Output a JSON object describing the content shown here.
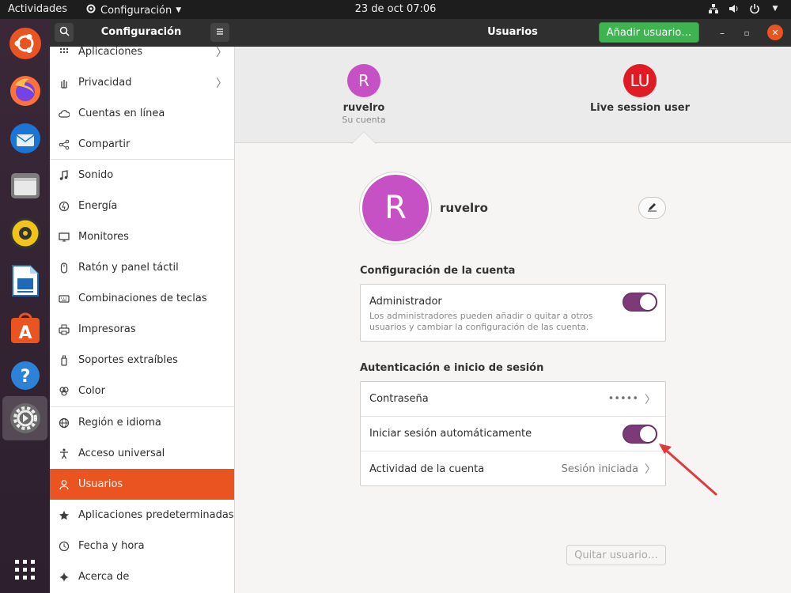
{
  "topbar": {
    "activities": "Actividades",
    "app_name": "Configuración",
    "clock": "23 de oct  07:06",
    "tray_icons": [
      "network-icon",
      "volume-icon",
      "power-icon",
      "menu-arrow-icon"
    ]
  },
  "dock": {
    "apps": [
      "ubuntu-logo-icon",
      "firefox-icon",
      "thunderbird-icon",
      "files-icon",
      "rhythmbox-icon",
      "writer-icon",
      "software-icon",
      "help-icon",
      "settings-icon",
      "app-grid-icon"
    ]
  },
  "header": {
    "search_icon": "search-icon",
    "sidebar_title": "Configuración",
    "menu_icon": "hamburger-icon",
    "title": "Usuarios",
    "add_user": "Añadir usuario…",
    "window_controls": [
      "minimize",
      "maximize",
      "close"
    ]
  },
  "sidebar": {
    "items": [
      {
        "label": "Aplicaciones",
        "icon": "grid-icon",
        "chevron": true
      },
      {
        "label": "Privacidad",
        "icon": "hand-icon",
        "chevron": true
      },
      {
        "label": "Cuentas en línea",
        "icon": "cloud-icon",
        "chevron": false
      },
      {
        "label": "Compartir",
        "icon": "share-icon",
        "chevron": false
      },
      {
        "label": "Sonido",
        "icon": "music-icon",
        "chevron": false
      },
      {
        "label": "Energía",
        "icon": "power-icon",
        "chevron": false
      },
      {
        "label": "Monitores",
        "icon": "monitor-icon",
        "chevron": false
      },
      {
        "label": "Ratón y panel táctil",
        "icon": "mouse-icon",
        "chevron": false
      },
      {
        "label": "Combinaciones de teclas",
        "icon": "keyboard-icon",
        "chevron": false
      },
      {
        "label": "Impresoras",
        "icon": "printer-icon",
        "chevron": false
      },
      {
        "label": "Soportes extraíbles",
        "icon": "usb-icon",
        "chevron": false
      },
      {
        "label": "Color",
        "icon": "color-icon",
        "chevron": false
      },
      {
        "label": "Región e idioma",
        "icon": "globe-icon",
        "chevron": false
      },
      {
        "label": "Acceso universal",
        "icon": "accessibility-icon",
        "chevron": false
      },
      {
        "label": "Usuarios",
        "icon": "user-icon",
        "chevron": false,
        "selected": true
      },
      {
        "label": "Aplicaciones predeterminadas",
        "icon": "star-icon",
        "chevron": false
      },
      {
        "label": "Fecha y hora",
        "icon": "clock-icon",
        "chevron": false
      },
      {
        "label": "Acerca de",
        "icon": "sparkle-icon",
        "chevron": false
      }
    ]
  },
  "carousel": {
    "users": [
      {
        "initials": "R",
        "name": "ruvelro",
        "subtitle": "Su cuenta",
        "color": "#c551c5"
      },
      {
        "initials": "LU",
        "name": "Live session user",
        "subtitle": "",
        "color": "#e01b24"
      }
    ]
  },
  "profile": {
    "initial": "R",
    "name": "ruvelro",
    "avatar_color": "#c551c5"
  },
  "account_settings": {
    "title": "Configuración de la cuenta",
    "admin_label": "Administrador",
    "admin_desc": "Los administradores pueden añadir o quitar a otros usuarios y cambiar la configuración de las cuenta.",
    "admin_enabled": true
  },
  "auth": {
    "title": "Autenticación e inicio de sesión",
    "password_label": "Contraseña",
    "password_value": "•••••",
    "autologin_label": "Iniciar sesión automáticamente",
    "autologin_enabled": true,
    "activity_label": "Actividad de la cuenta",
    "activity_value": "Sesión iniciada"
  },
  "remove_user": "Quitar usuario…",
  "colors": {
    "accent": "#e95420",
    "toggle_on": "#7c3a78",
    "add_button": "#3eb34f",
    "annotation_arrow": "#e0393e"
  }
}
